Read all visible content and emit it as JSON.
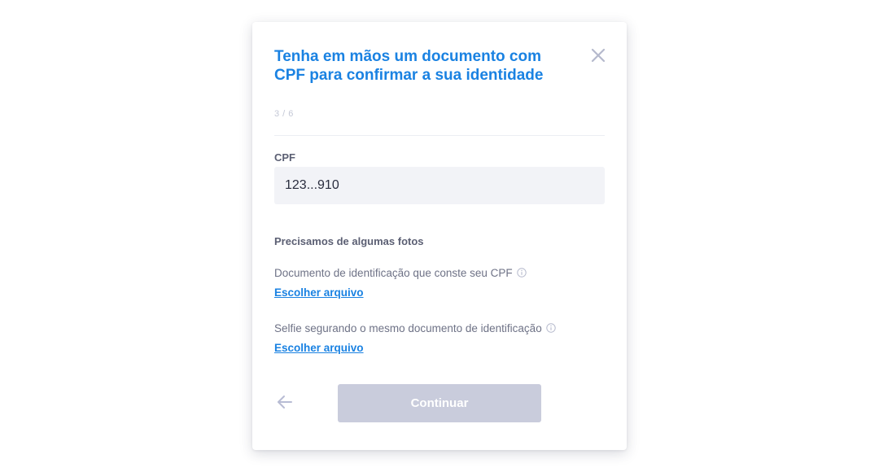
{
  "modal": {
    "title": "Tenha em mãos um documento com CPF para confirmar a sua identidade",
    "step": "3 / 6",
    "close_icon": "close-icon"
  },
  "cpf": {
    "label": "CPF",
    "value": "123...910"
  },
  "photos": {
    "heading": "Precisamos de algumas fotos",
    "items": [
      {
        "label": "Documento de identificação que conste seu CPF",
        "icon": "info-icon",
        "link": "Escolher arquivo"
      },
      {
        "label": "Selfie segurando o mesmo documento de identificação",
        "icon": "info-icon",
        "link": "Escolher arquivo"
      }
    ]
  },
  "footer": {
    "back_icon": "arrow-left-icon",
    "continue_label": "Continuar",
    "continue_disabled": true
  },
  "colors": {
    "accent": "#1a82e2",
    "disabled_button": "#c9ccdc",
    "input_bg": "#f2f3f7",
    "muted_text": "#6e7286"
  }
}
